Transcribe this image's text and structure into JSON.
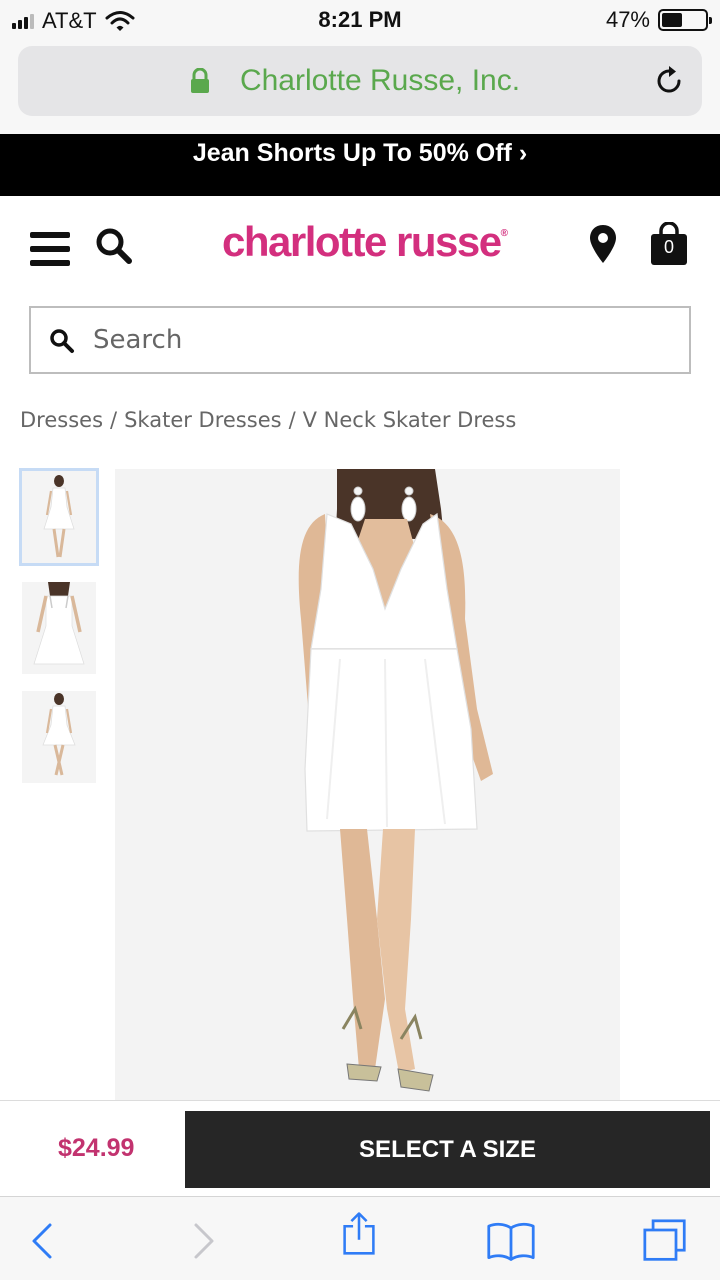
{
  "status_bar": {
    "carrier": "AT&T",
    "time": "8:21 PM",
    "battery": "47%",
    "battery_level": 0.47,
    "signal_bars": 3
  },
  "browser": {
    "address": "Charlotte Russe, Inc.",
    "address_color": "#5aa84d"
  },
  "promo": {
    "text": "Jean Shorts Up To 50% Off ›"
  },
  "header": {
    "logo": "charlotte russe",
    "logo_mark": "®",
    "bag_count": "0",
    "brand_color": "#d32f7e"
  },
  "search": {
    "placeholder": "Search"
  },
  "breadcrumb": {
    "items": [
      "Dresses",
      "Skater Dresses",
      "V Neck Skater Dress"
    ],
    "separator": "/"
  },
  "buy_bar": {
    "price": "$24.99",
    "cta": "SELECT A SIZE",
    "price_color": "#c2336f"
  },
  "icons": {
    "lock": "lock-icon",
    "reload": "reload-icon",
    "menu": "menu-icon",
    "search": "search-icon",
    "location": "location-pin-icon",
    "bag": "shopping-bag-icon",
    "back": "back-icon",
    "forward": "forward-icon",
    "share": "share-icon",
    "bookmarks": "bookmarks-icon",
    "tabs": "tabs-icon"
  }
}
